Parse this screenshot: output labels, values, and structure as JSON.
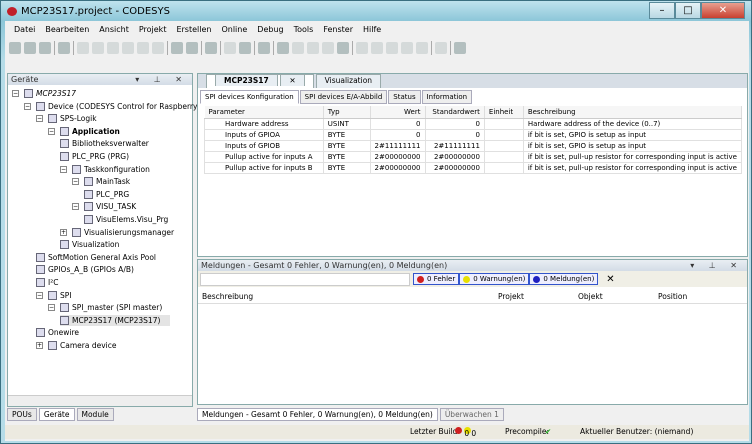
{
  "window": {
    "title": "MCP23S17.project - CODESYS",
    "controls": [
      "–",
      "□",
      "✕"
    ]
  },
  "menu": [
    "Datei",
    "Bearbeiten",
    "Ansicht",
    "Projekt",
    "Erstellen",
    "Online",
    "Debug",
    "Tools",
    "Fenster",
    "Hilfe"
  ],
  "devices_panel": {
    "title": "Geräte",
    "controls": "▾ ⊥ ✕",
    "tree": [
      {
        "label": "MCP23S17",
        "level": 0,
        "expander": "−",
        "italic": true
      },
      {
        "label": "Device (CODESYS Control for Raspberry Pi)",
        "level": 1,
        "expander": "−"
      },
      {
        "label": "SPS-Logik",
        "level": 2,
        "expander": "−"
      },
      {
        "label": "Application",
        "level": 3,
        "expander": "−",
        "bold": true
      },
      {
        "label": "Bibliotheksverwalter",
        "level": 4
      },
      {
        "label": "PLC_PRG (PRG)",
        "level": 4
      },
      {
        "label": "Taskkonfiguration",
        "level": 4,
        "expander": "−"
      },
      {
        "label": "MainTask",
        "level": 5,
        "expander": "−"
      },
      {
        "label": "PLC_PRG",
        "level": 6
      },
      {
        "label": "VISU_TASK",
        "level": 5,
        "expander": "−"
      },
      {
        "label": "VisuElems.Visu_Prg",
        "level": 6
      },
      {
        "label": "Visualisierungsmanager",
        "level": 4,
        "expander": "+"
      },
      {
        "label": "Visualization",
        "level": 4
      },
      {
        "label": "SoftMotion General Axis Pool",
        "level": 2
      },
      {
        "label": "GPIOs_A_B (GPIOs A/B)",
        "level": 2
      },
      {
        "label": "I²C",
        "level": 2
      },
      {
        "label": "SPI",
        "level": 2,
        "expander": "−"
      },
      {
        "label": "SPI_master (SPI master)",
        "level": 3,
        "expander": "−"
      },
      {
        "label": "MCP23S17 (MCP23S17)",
        "level": 4,
        "selected": true
      },
      {
        "label": "Onewire",
        "level": 2
      },
      {
        "label": "Camera device",
        "level": 2,
        "expander": "+"
      }
    ],
    "tabs": [
      "POUs",
      "Geräte",
      "Module"
    ],
    "active_tab": "Geräte"
  },
  "editor": {
    "tabs": [
      "MCP23S17",
      "Visualization"
    ],
    "close": "✕",
    "subtabs": [
      "SPI devices Konfiguration",
      "SPI devices E/A-Abbild",
      "Status",
      "Information"
    ],
    "columns": [
      "Parameter",
      "Typ",
      "Wert",
      "Standardwert",
      "Einheit",
      "Beschreibung"
    ],
    "rows": [
      [
        "Hardware address",
        "USINT",
        "0",
        "0",
        "",
        "Hardware address of the device (0..7)"
      ],
      [
        "Inputs of GPIOA",
        "BYTE",
        "0",
        "0",
        "",
        "if bit is set, GPIO is setup as input"
      ],
      [
        "Inputs of GPIOB",
        "BYTE",
        "2#11111111",
        "2#11111111",
        "",
        "if bit is set, GPIO is setup as input"
      ],
      [
        "Pullup active for inputs A",
        "BYTE",
        "2#00000000",
        "2#00000000",
        "",
        "if bit is set, pull-up resistor for corresponding input is active"
      ],
      [
        "Pullup active for inputs B",
        "BYTE",
        "2#00000000",
        "2#00000000",
        "",
        "if bit is set, pull-up resistor for corresponding input is active"
      ]
    ]
  },
  "messages": {
    "title": "Meldungen - Gesamt 0 Fehler, 0 Warnung(en), 0 Meldung(en)",
    "controls": "▾ ⊥ ✕",
    "errors": "0 Fehler",
    "warnings": "0 Warnung(en)",
    "infos": "0 Meldung(en)",
    "clear": "✕",
    "columns": [
      "Beschreibung",
      "Projekt",
      "Objekt",
      "Position"
    ]
  },
  "bottom_tabs": [
    "Meldungen - Gesamt 0 Fehler, 0 Warnung(en), 0 Meldung(en)",
    "Überwachen 1"
  ],
  "status": {
    "last_build": "Letzter Build",
    "errors": "0",
    "warnings": "0",
    "precompile": "Precompile:",
    "precompile_ok": "✔",
    "user": "Aktueller Benutzer: (niemand)"
  },
  "colors": {
    "error": "#d02020",
    "warning": "#e8e000",
    "info": "#2020c0",
    "accent": "#3355cc"
  }
}
